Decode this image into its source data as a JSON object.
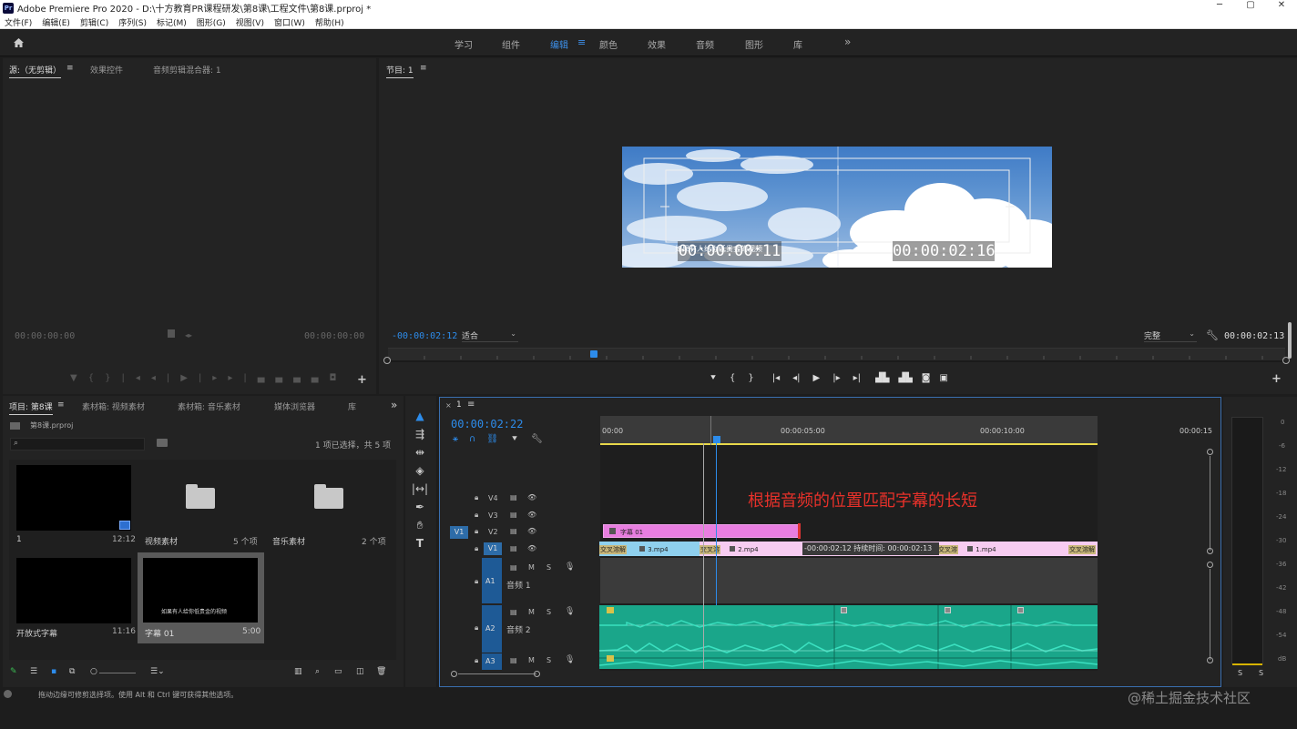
{
  "app": {
    "title": "Adobe Premiere Pro 2020 - D:\\十方教育PR课程研发\\第8课\\工程文件\\第8课.prproj *",
    "pr_icon": "Pr",
    "window_controls": [
      "─",
      "▢",
      "✕"
    ]
  },
  "menu": [
    "文件(F)",
    "编辑(E)",
    "剪辑(C)",
    "序列(S)",
    "标记(M)",
    "图形(G)",
    "视图(V)",
    "窗口(W)",
    "帮助(H)"
  ],
  "workspaces": {
    "items": [
      "学习",
      "组件",
      "编辑",
      "颜色",
      "效果",
      "音频",
      "图形",
      "库"
    ],
    "active": "编辑",
    "more": "»"
  },
  "source_panel": {
    "tabs": [
      "源:（无剪辑）",
      "效果控件",
      "音频剪辑混合器: 1"
    ],
    "active_tab": "源:（无剪辑）",
    "tc_left": "00:00:00:00",
    "tc_right": "00:00:00:00"
  },
  "program_panel": {
    "tab": "节目: 1",
    "timecode": "-00:00:02:12",
    "fit": "适合",
    "quality": "完整",
    "duration": "00:00:02:13",
    "overlay_tc_left": "00:00:00:11",
    "overlay_tc_right": "00:00:02:16",
    "subtitle_overlay": "如果有人给你低贵金的视频"
  },
  "project_panel": {
    "tabs": [
      "项目: 第8课",
      "素材箱: 视频素材",
      "素材箱: 音乐素材",
      "媒体浏览器",
      "库"
    ],
    "active_tab": "项目: 第8课",
    "project_file": "第8课.prproj",
    "selection_info": "1 项已选择，共 5 项",
    "items": [
      {
        "label": "1",
        "meta": "12:12",
        "kind": "sequence"
      },
      {
        "label": "视频素材",
        "meta": "5 个项",
        "kind": "bin"
      },
      {
        "label": "音乐素材",
        "meta": "2 个项",
        "kind": "bin"
      },
      {
        "label": "开放式字幕",
        "meta": "11:16",
        "kind": "caption"
      },
      {
        "label": "字幕 01",
        "meta": "5:00",
        "kind": "title",
        "preview_text": "如果有人给你低贵金的视频"
      }
    ]
  },
  "timeline": {
    "sequence_tab": "1",
    "timecode": "00:00:02:22",
    "ruler": [
      "00:00",
      "00:00:05:00",
      "00:00:10:00",
      "00:00:15"
    ],
    "annotation": "根据音频的位置匹配字幕的长短",
    "tooltip": "-00:00:02:12 持续时间: 00:00:02:13",
    "video_tracks": [
      "V4",
      "V3",
      "V2",
      "V1"
    ],
    "audio_tracks": [
      "A1",
      "A2",
      "A3"
    ],
    "audio_names": {
      "A1": "音频 1",
      "A2": "音频 2"
    },
    "source_patch": "V1",
    "clips": {
      "title_clip": "字幕 01",
      "v1": [
        "交叉溶解",
        "3.mp4",
        "交叉溶",
        "2.mp4",
        "交叉溶",
        "1.mp4",
        "交叉溶解"
      ]
    },
    "track_btns": {
      "m": "M",
      "s": "S"
    }
  },
  "meters": {
    "labels": [
      "0",
      "-6",
      "-12",
      "-18",
      "-24",
      "-30",
      "-36",
      "-42",
      "-48",
      "-54",
      "dB"
    ],
    "solo": [
      "S",
      "S"
    ]
  },
  "status_bar": {
    "text": "拖动边缘可修剪选择项。使用 Alt 和 Ctrl 键可获得其他选项。",
    "watermark": "@稀土掘金技术社区"
  },
  "colors": {
    "accent_blue": "#2d8ceb",
    "title_clip": "#e87ee0",
    "v1_clip": "#f5c6ef",
    "audio_clip": "#1aa68a",
    "annotation": "#e8312a"
  }
}
